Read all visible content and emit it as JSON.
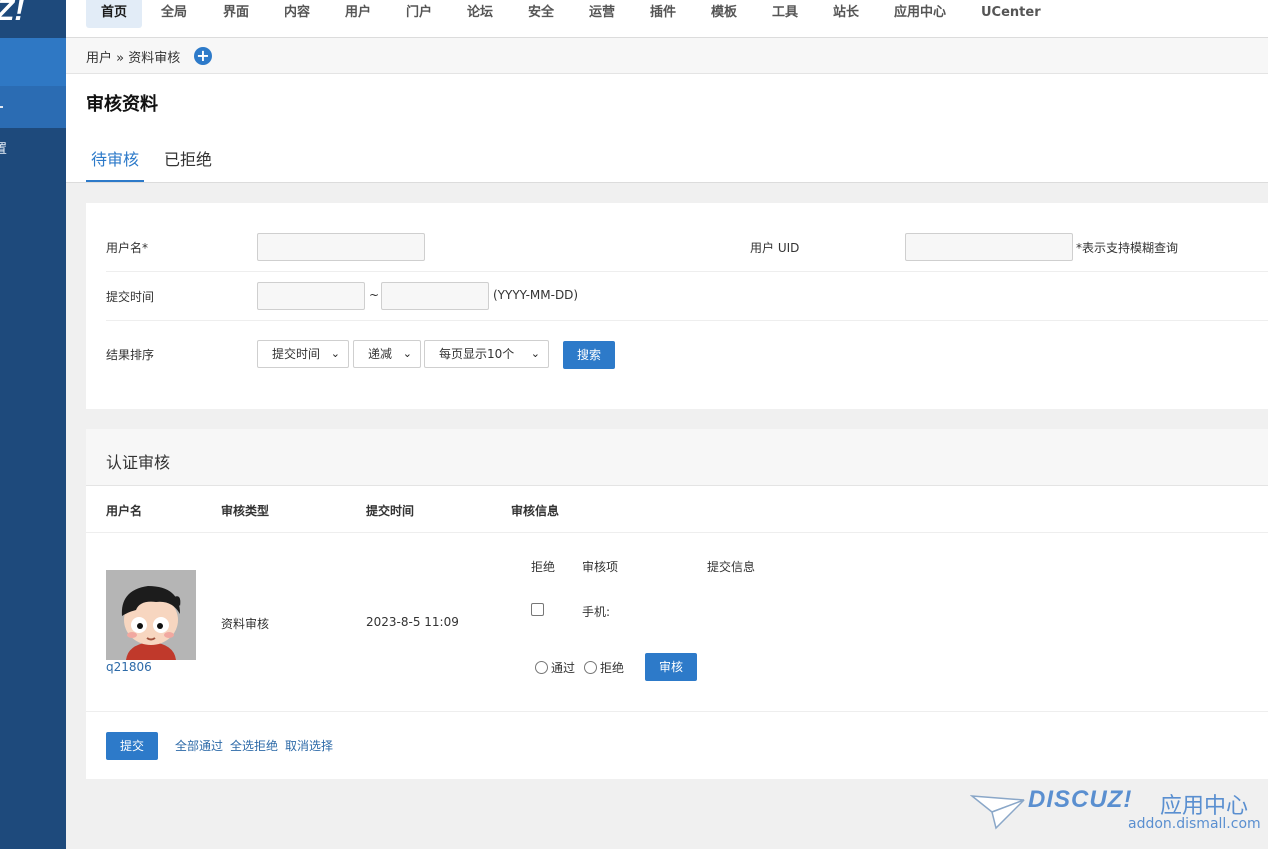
{
  "sidebar": {
    "logo": "Z!",
    "item_fragment": "置"
  },
  "topnav": {
    "items": [
      "首页",
      "全局",
      "界面",
      "内容",
      "用户",
      "门户",
      "论坛",
      "安全",
      "运营",
      "插件",
      "模板",
      "工具",
      "站长",
      "应用中心",
      "UCenter"
    ],
    "active_index": 0
  },
  "breadcrumb": {
    "text": "用户 » 资料审核",
    "add_icon": "plus-circle-icon"
  },
  "page": {
    "title": "审核资料",
    "tabs": [
      "待审核",
      "已拒绝"
    ],
    "active_tab": 0
  },
  "search": {
    "username_label": "用户名*",
    "uid_label": "用户 UID",
    "fuzzy_hint": "*表示支持模糊查询",
    "time_label": "提交时间",
    "range_sep": "~",
    "date_format": "(YYYY-MM-DD)",
    "sort_label": "结果排序",
    "sort_field": "提交时间",
    "sort_order": "递减",
    "per_page": "每页显示10个",
    "search_button": "搜索"
  },
  "audit": {
    "title": "认证审核",
    "columns": [
      "用户名",
      "审核类型",
      "提交时间",
      "审核信息"
    ],
    "sub_columns": [
      "拒绝",
      "审核项",
      "提交信息"
    ],
    "rows": [
      {
        "username": "q21806",
        "type": "资料审核",
        "time": "2023-8-5 11:09",
        "field": "手机:",
        "pass_label": "通过",
        "reject_label": "拒绝",
        "review_button": "审核"
      }
    ],
    "submit_button": "提交",
    "actions": [
      "全部通过",
      "全选拒绝",
      "取消选择"
    ]
  },
  "watermark": {
    "brand": "DISCUZ!",
    "cn": "应用中心",
    "url": "addon.dismall.com"
  },
  "colors": {
    "accent": "#2d7ac9",
    "sidebar": "#1e4a7c",
    "link": "#2d6aa8"
  }
}
